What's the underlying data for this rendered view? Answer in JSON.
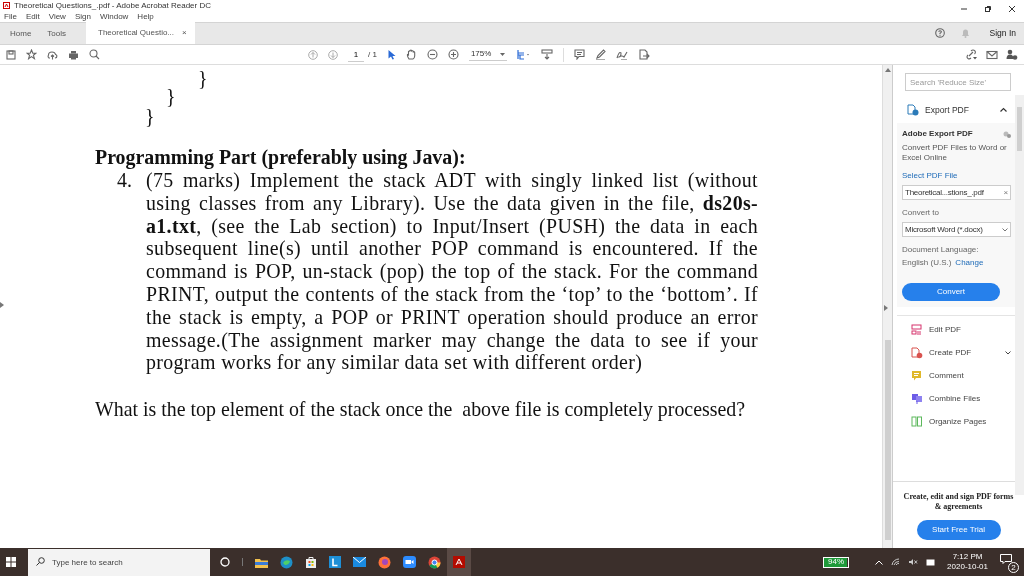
{
  "window": {
    "title": "Theoretical Questions_.pdf - Adobe Acrobat Reader DC"
  },
  "menu": [
    "File",
    "Edit",
    "View",
    "Sign",
    "Window",
    "Help"
  ],
  "tabs": [
    {
      "label": "Home",
      "selected": false,
      "closable": false
    },
    {
      "label": "Tools",
      "selected": false,
      "closable": false
    },
    {
      "label": "Theoretical Questio...",
      "selected": true,
      "closable": true
    }
  ],
  "close_glyph": "×",
  "account": {
    "sign_in": "Sign In"
  },
  "toolbar": {
    "page": "1",
    "page_total": "/ 1",
    "zoom": "175%"
  },
  "document": {
    "braces": [
      "}",
      "}",
      "}"
    ],
    "heading": "Programming Part (preferably using Java):",
    "item_number": "4.",
    "item_text": "(75 marks) Implement the stack ADT with singly linked list (without using classes from any Library). Use the data given in the file, **ds20s-a1.txt**, (see the Lab section) to Input/Insert (PUSH) the data in each subsequent line(s) until another POP command is encountered. If the command is POP, un-stack (pop) the top of the stack. For the command PRINT, output the contents of the stack from the ‘top’ to the ‘bottom’. If the stack is empty, a POP or PRINT operation should produce an error message.(The assignment marker may change the data to see if your program works for any similar data set with different order)",
    "question": "What is the top element of the stack once the  above file is completely processed?"
  },
  "panel": {
    "search": {
      "placeholder": "Search 'Reduce Size'"
    },
    "export": {
      "title": "Export PDF",
      "expanded": true,
      "heading": "Adobe Export PDF",
      "description": "Convert PDF Files to Word or Excel Online",
      "select_label": "Select PDF File",
      "file": "Theoretical...stions_.pdf",
      "convert_label": "Convert to",
      "format": "Microsoft Word (*.docx)",
      "language_label": "Document Language:",
      "language": "English (U.S.)",
      "change": "Change",
      "button": "Convert"
    },
    "tools": [
      {
        "label": "Edit PDF",
        "kind": "edit",
        "has_menu": false
      },
      {
        "label": "Create PDF",
        "kind": "create",
        "has_menu": true
      },
      {
        "label": "Comment",
        "kind": "comment",
        "has_menu": false
      },
      {
        "label": "Combine Files",
        "kind": "combine",
        "has_menu": false
      },
      {
        "label": "Organize Pages",
        "kind": "organize",
        "has_menu": false
      }
    ],
    "promo": "Create, edit and sign PDF forms & agreements",
    "trial": "Start Free Trial"
  },
  "taskbar": {
    "search": {
      "placeholder": "Type here to search"
    },
    "battery": {
      "reading": "94%",
      "level": 0.94
    },
    "time": "7:12 PM",
    "date": "2020-10-01",
    "notifications": "2"
  }
}
